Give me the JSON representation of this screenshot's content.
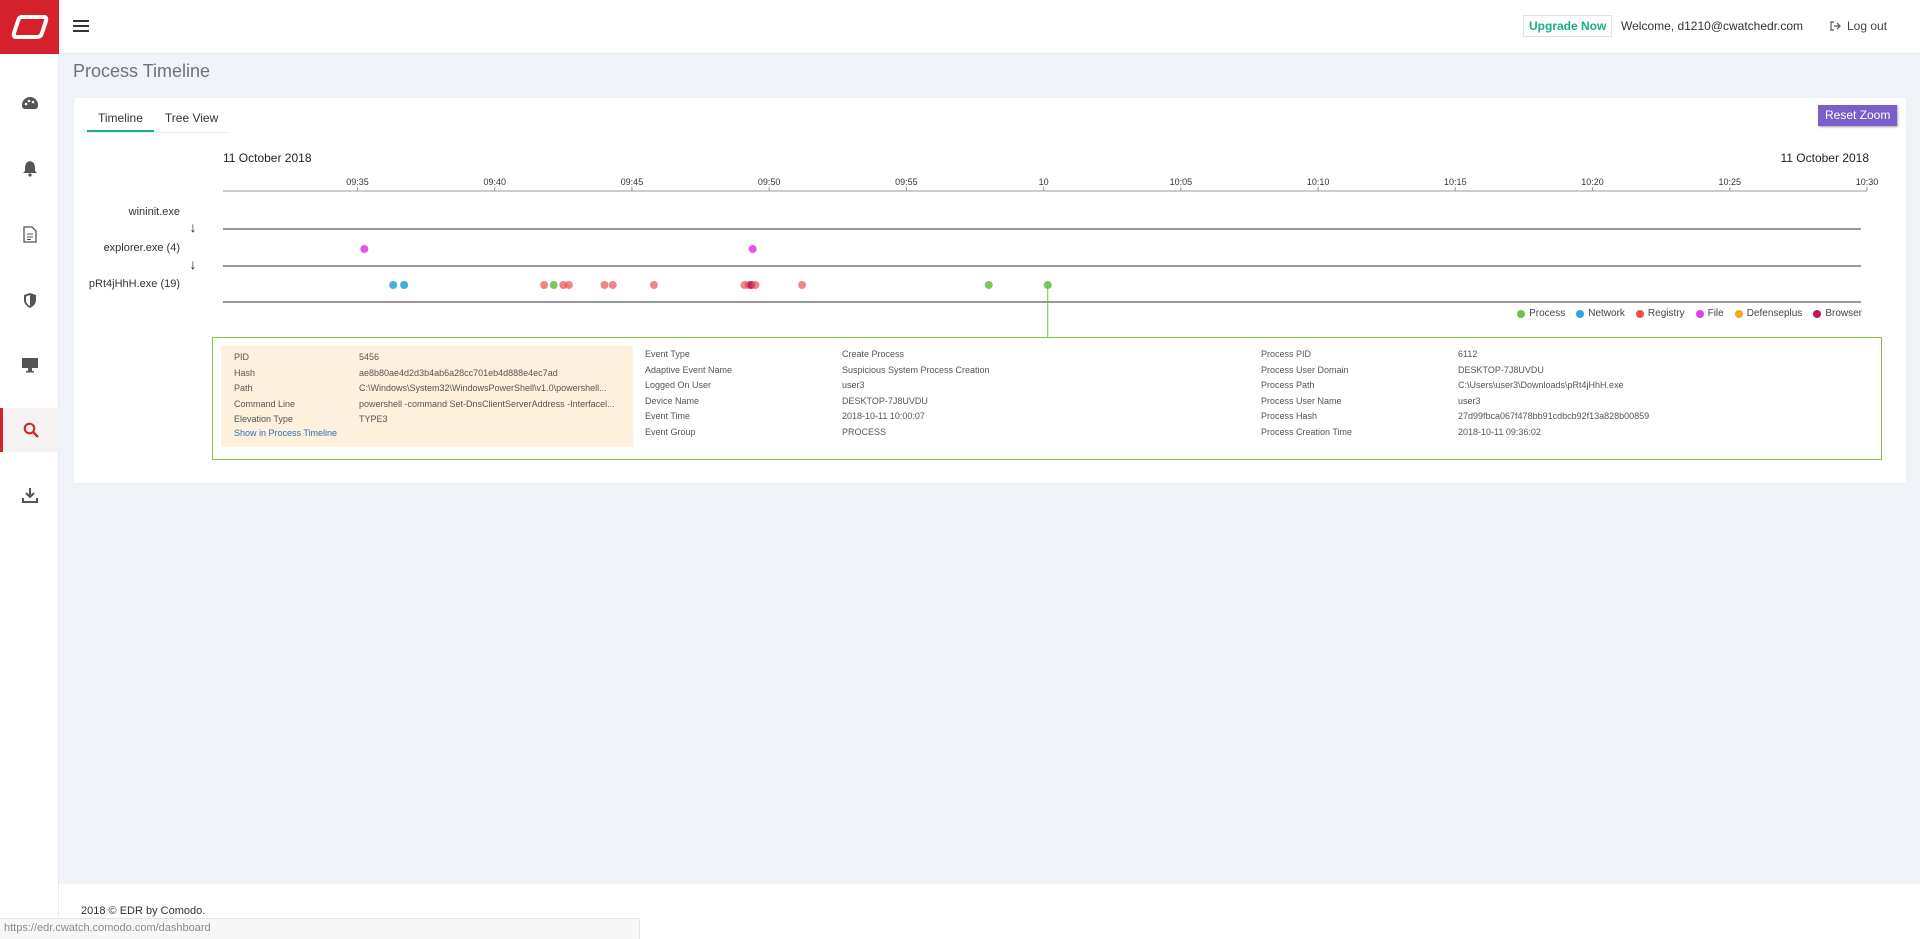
{
  "header": {
    "upgrade_label": "Upgrade Now",
    "welcome_text": "Welcome, d1210@cwatchedr.com",
    "logout_label": "Log out"
  },
  "sidebar": {
    "items": [
      {
        "name": "dashboard",
        "icon": "palette-icon"
      },
      {
        "name": "alerts",
        "icon": "bell-icon"
      },
      {
        "name": "reports",
        "icon": "document-icon"
      },
      {
        "name": "policies",
        "icon": "shield-icon"
      },
      {
        "name": "devices",
        "icon": "monitor-icon"
      },
      {
        "name": "investigation",
        "icon": "search-icon",
        "active": true
      },
      {
        "name": "downloads",
        "icon": "download-icon"
      }
    ]
  },
  "page": {
    "title": "Process Timeline",
    "tabs": [
      {
        "label": "Timeline",
        "active": true
      },
      {
        "label": "Tree View",
        "active": false
      }
    ],
    "reset_zoom_label": "Reset Zoom"
  },
  "timeline": {
    "date_left": "11 October 2018",
    "date_right": "11 October 2018",
    "ticks": [
      "09:35",
      "09:40",
      "09:45",
      "09:50",
      "09:55",
      "10",
      "10:05",
      "10:10",
      "10:15",
      "10:20",
      "10:25",
      "10:30"
    ],
    "start_minutes": 570.1,
    "end_minutes": 630.0,
    "rows": [
      {
        "label": "wininit.exe",
        "events": []
      },
      {
        "label": "explorer.exe (4)",
        "events": [
          {
            "t": 575.25,
            "type": "File"
          },
          {
            "t": 589.4,
            "type": "File"
          }
        ]
      },
      {
        "label": "pRt4jHhH.exe (19)",
        "events": [
          {
            "t": 576.3,
            "type": "Network"
          },
          {
            "t": 576.7,
            "type": "Network"
          },
          {
            "t": 581.8,
            "type": "Registry"
          },
          {
            "t": 582.15,
            "type": "Process"
          },
          {
            "t": 582.5,
            "type": "Registry"
          },
          {
            "t": 582.7,
            "type": "Registry"
          },
          {
            "t": 584.0,
            "type": "Registry"
          },
          {
            "t": 584.3,
            "type": "Registry"
          },
          {
            "t": 585.8,
            "type": "Registry"
          },
          {
            "t": 589.1,
            "type": "Registry"
          },
          {
            "t": 589.25,
            "type": "Registry"
          },
          {
            "t": 589.35,
            "type": "Browser"
          },
          {
            "t": 589.5,
            "type": "Registry"
          },
          {
            "t": 591.2,
            "type": "Registry"
          },
          {
            "t": 598.0,
            "type": "Process"
          },
          {
            "t": 600.15,
            "type": "Process",
            "selected": true
          }
        ]
      }
    ],
    "legend": [
      {
        "label": "Process",
        "color": "#6cc24a"
      },
      {
        "label": "Network",
        "color": "#2aa8d6"
      },
      {
        "label": "Registry",
        "color": "#f04e4e"
      },
      {
        "label": "File",
        "color": "#e040e8"
      },
      {
        "label": "Defenseplus",
        "color": "#f5a623"
      },
      {
        "label": "Browser",
        "color": "#c0185a"
      }
    ]
  },
  "details": {
    "source": [
      {
        "key": "PID",
        "value": "5456"
      },
      {
        "key": "Hash",
        "value": "ae8b80ae4d2d3b4ab6a28cc701eb4d888e4ec7ad",
        "link": true
      },
      {
        "key": "Path",
        "value": "C:\\Windows\\System32\\WindowsPowerShell\\v1.0\\powershell...",
        "link": true
      },
      {
        "key": "Command Line",
        "value": "powershell -command Set-DnsClientServerAddress -Interfacel..."
      },
      {
        "key": "Elevation Type",
        "value": "TYPE3"
      }
    ],
    "show_in_timeline_label": "Show in Process Timeline",
    "event": [
      {
        "key": "Event Type",
        "value": "Create Process"
      },
      {
        "key": "Adaptive Event Name",
        "value": "Suspicious System Process Creation"
      },
      {
        "key": "Logged On User",
        "value": "user3"
      },
      {
        "key": "Device Name",
        "value": "DESKTOP-7J8UVDU",
        "link": true
      },
      {
        "key": "Event Time",
        "value": "2018-10-11 10:00:07"
      },
      {
        "key": "Event Group",
        "value": "PROCESS"
      }
    ],
    "process": [
      {
        "key": "Process PID",
        "value": "6112"
      },
      {
        "key": "Process User Domain",
        "value": "DESKTOP-7J8UVDU"
      },
      {
        "key": "Process Path",
        "value": "C:\\Users\\user3\\Downloads\\pRt4jHhH.exe",
        "link": true
      },
      {
        "key": "Process User Name",
        "value": "user3"
      },
      {
        "key": "Process Hash",
        "value": "27d99fbca067f478bb91cdbcb92f13a828b00859",
        "link": true
      },
      {
        "key": "Process Creation Time",
        "value": "2018-10-11 09:36:02"
      }
    ]
  },
  "footer": {
    "text": "2018 © EDR by Comodo."
  },
  "status_bar": {
    "url": "https://edr.cwatch.comodo.com/dashboard"
  }
}
